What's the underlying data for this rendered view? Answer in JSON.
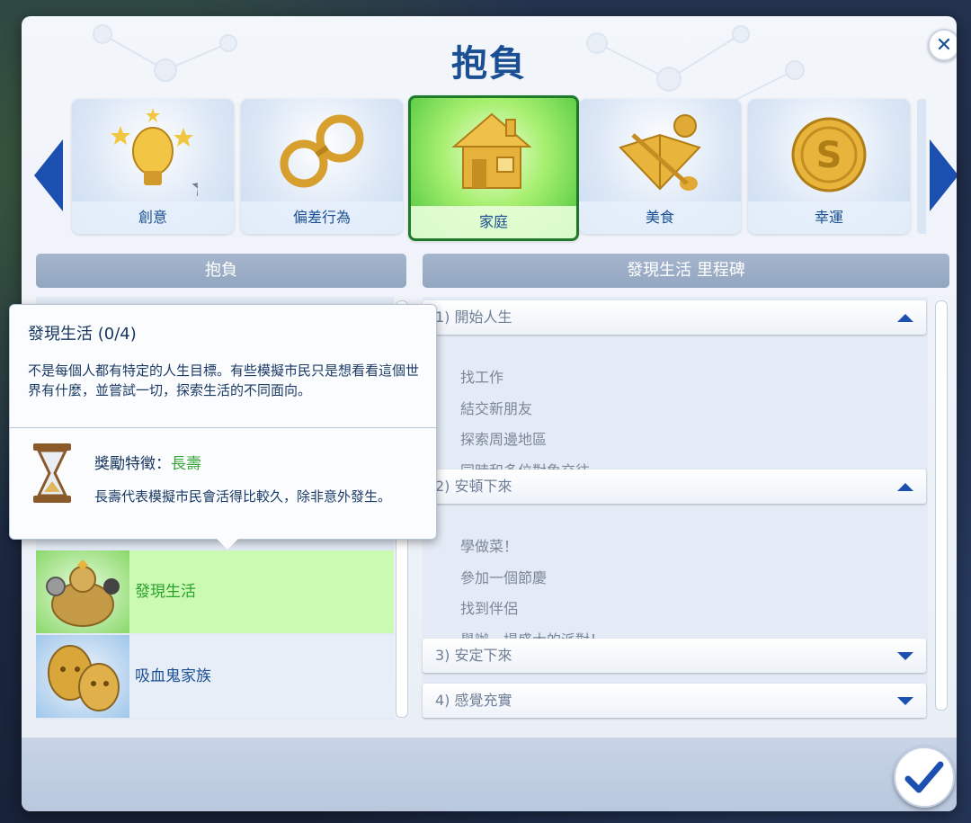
{
  "dialog": {
    "title": "抱負",
    "close_symbol": "✕"
  },
  "categories": [
    {
      "label": "創意",
      "icon": "lightbulb-stars-icon"
    },
    {
      "label": "偏差行為",
      "icon": "handcuffs-icon"
    },
    {
      "label": "家庭",
      "icon": "house-icon",
      "selected": true
    },
    {
      "label": "美食",
      "icon": "cookbook-icon"
    },
    {
      "label": "幸運",
      "icon": "coin-icon"
    }
  ],
  "left_panel": {
    "header": "抱負",
    "items": [
      {
        "label": "發現生活",
        "icon": "muscle-figure-icon",
        "active": true
      },
      {
        "label": "吸血鬼家族",
        "icon": "vampire-faces-icon",
        "active": false
      }
    ]
  },
  "tooltip": {
    "title": "發現生活 (0/4)",
    "description": "不是每個人都有特定的人生目標。有些模擬市民只是想看看這個世界有什麼，並嘗試一切，探索生活的不同面向。",
    "reward_label": "獎勵特徵：",
    "reward_trait": "長壽",
    "reward_description": "長壽代表模擬市民會活得比較久，除非意外發生。",
    "icon": "hourglass-icon"
  },
  "right_panel": {
    "header": "發現生活 里程碑",
    "milestones": [
      {
        "title": "1) 開始人生",
        "expanded": true,
        "tasks": [
          "找工作",
          "結交新朋友",
          "探索周邊地區",
          "同時和多位對象交往"
        ]
      },
      {
        "title": "2) 安頓下來",
        "expanded": true,
        "tasks": [
          "學做菜！",
          "參加一個節慶",
          "找到伴侶",
          "舉辦一場盛大的派對！"
        ]
      },
      {
        "title": "3) 安定下來",
        "expanded": false,
        "tasks": []
      },
      {
        "title": "4) 感覺充實",
        "expanded": false,
        "tasks": []
      }
    ]
  },
  "colors": {
    "accent": "#1b4fb0",
    "selected_green": "#46c23b",
    "title_blue": "#1b4f93"
  }
}
